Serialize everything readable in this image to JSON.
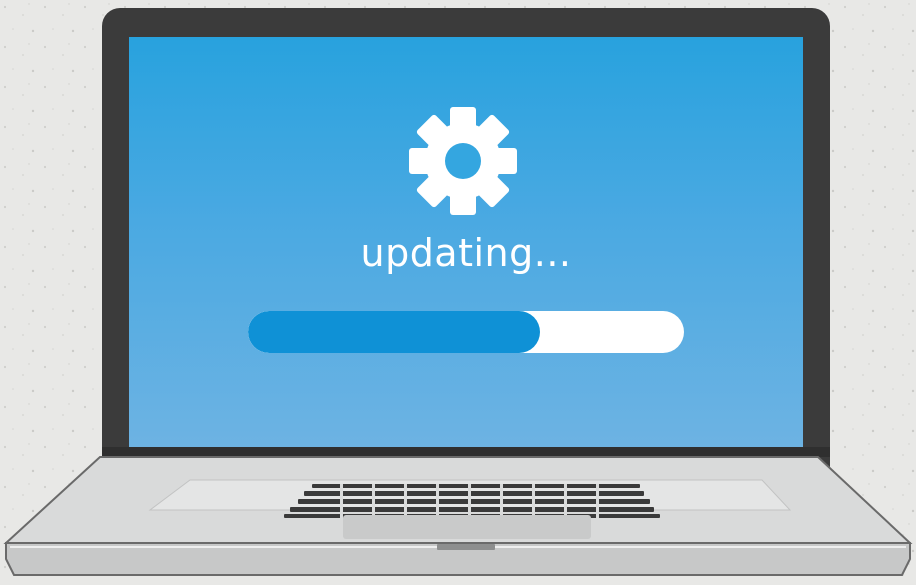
{
  "screen": {
    "status_text": "updating...",
    "icon": "gear-icon",
    "progress": 0.67
  },
  "colors": {
    "screen_top": "#28a2de",
    "screen_bottom": "#6db3e3",
    "progress_fill": "#0f91d6",
    "progress_track": "#ffffff",
    "bezel": "#3b3b3b",
    "body": "#d7d8d8"
  }
}
